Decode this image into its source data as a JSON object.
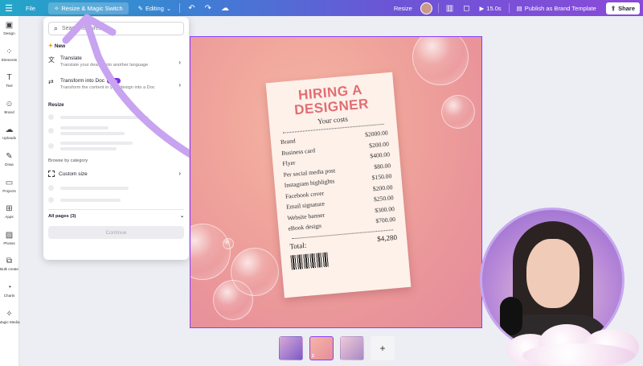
{
  "topbar": {
    "file": "File",
    "resize_magic_switch": "Resize & Magic Switch",
    "editing": "Editing",
    "resize": "Resize",
    "timer": "15.0s",
    "publish": "Publish as Brand Template",
    "share": "Share"
  },
  "rail": {
    "items": [
      {
        "label": "Design",
        "icon": "▣"
      },
      {
        "label": "Elements",
        "icon": "⁘"
      },
      {
        "label": "Text",
        "icon": "T"
      },
      {
        "label": "Brand",
        "icon": "☺"
      },
      {
        "label": "Uploads",
        "icon": "☁"
      },
      {
        "label": "Draw",
        "icon": "✎"
      },
      {
        "label": "Projects",
        "icon": "▭"
      },
      {
        "label": "Apps",
        "icon": "⊞"
      },
      {
        "label": "Photos",
        "icon": "▨"
      },
      {
        "label": "Bulk create",
        "icon": "⧉"
      },
      {
        "label": "Charts",
        "icon": "◔"
      },
      {
        "label": "Magic Media",
        "icon": "✧"
      }
    ]
  },
  "panel": {
    "search_placeholder": "Search features",
    "new_label": "New",
    "translate_title": "Translate",
    "translate_desc": "Translate your design into another language",
    "transform_title": "Transform into Doc",
    "transform_badge": "New",
    "transform_desc": "Transform the content in your design into a Doc",
    "resize_header": "Resize",
    "browse_header": "Browse by category",
    "custom_size": "Custom size",
    "all_pages": "All pages (3)",
    "continue": "Continue"
  },
  "receipt": {
    "title_line1": "HIRING A",
    "title_line2": "DESIGNER",
    "subtitle": "Your costs",
    "items": [
      {
        "name": "Brand",
        "price": "$2000.00"
      },
      {
        "name": "Business card",
        "price": "$200.00"
      },
      {
        "name": "Flyer",
        "price": "$400.00"
      },
      {
        "name": "Per social media post",
        "price": "$80.00"
      },
      {
        "name": "Instagram highlights",
        "price": "$150.00"
      },
      {
        "name": "Facebook cover",
        "price": "$200.00"
      },
      {
        "name": "Email signature",
        "price": "$250.00"
      },
      {
        "name": "Website banner",
        "price": "$300.00"
      },
      {
        "name": "eBook design",
        "price": "$700.00"
      }
    ],
    "total_label": "Total:",
    "total_value": "$4,280"
  },
  "pages": {
    "selected_page": "2",
    "add": "+"
  },
  "colors": {
    "brand_purple": "#8b3dff",
    "receipt_title": "#e26d72"
  }
}
